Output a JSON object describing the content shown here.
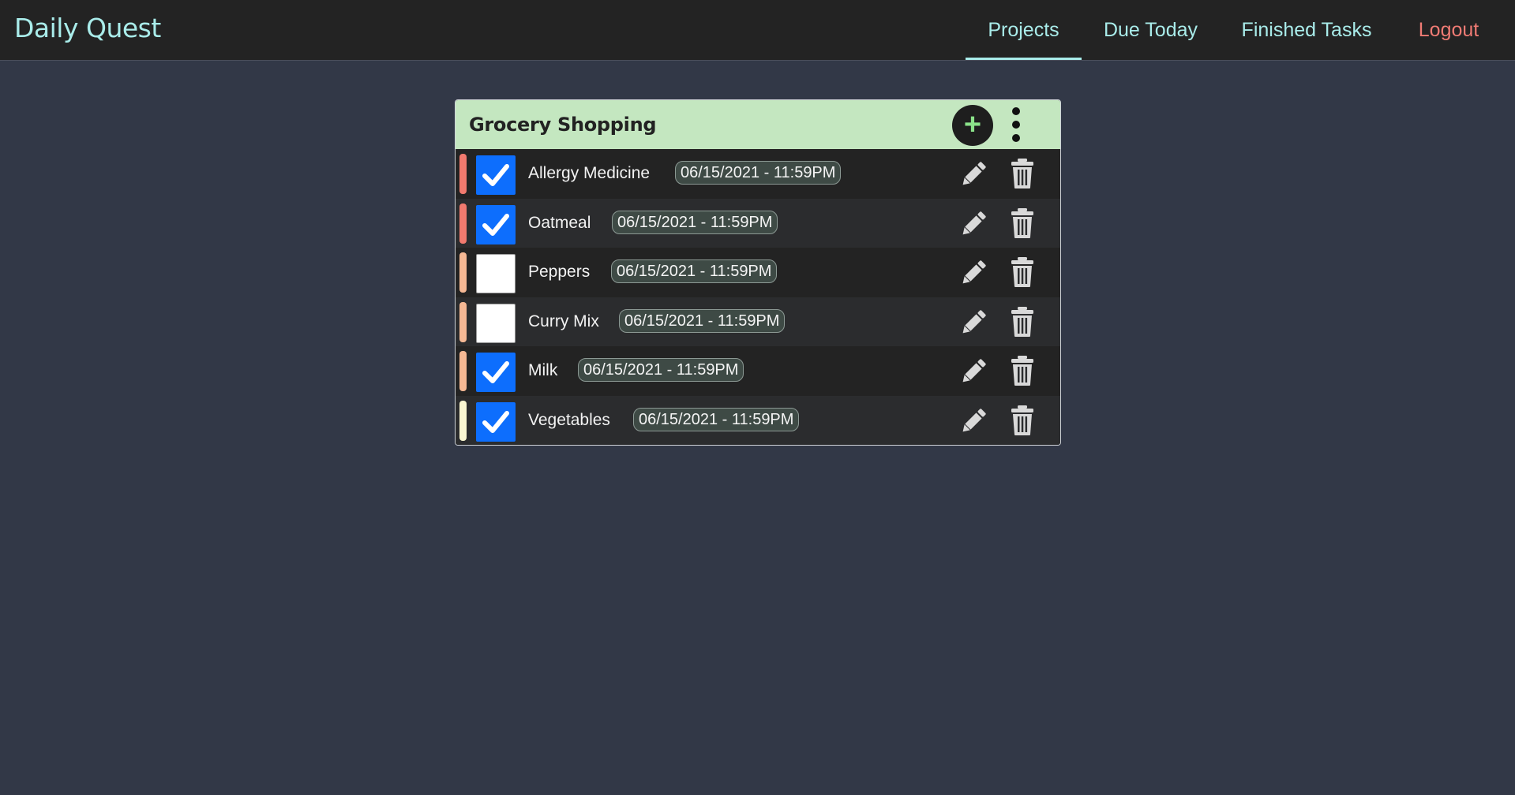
{
  "app": {
    "brand": "Daily Quest"
  },
  "nav": {
    "items": [
      {
        "label": "Projects",
        "active": true
      },
      {
        "label": "Due Today",
        "active": false
      },
      {
        "label": "Finished Tasks",
        "active": false
      },
      {
        "label": "Logout",
        "active": false
      }
    ]
  },
  "colors": {
    "background": "#323847",
    "navbar": "#232323",
    "brand_accent": "#a9ecea",
    "logout": "#f07b74",
    "header": "#c4e7c0",
    "add_plus": "#8be38a",
    "checkbox_checked": "#0d6efd",
    "priority_high": "#f27a6e",
    "priority_medium": "#f5b894",
    "priority_low": "#fbf7d2"
  },
  "project": {
    "title": "Grocery Shopping",
    "add_icon": "plus-icon",
    "menu_icon": "vertical-dots-icon",
    "tasks": [
      {
        "name": "Allergy Medicine",
        "due": "06/15/2021 - 11:59PM",
        "completed": true,
        "priority": "high"
      },
      {
        "name": "Oatmeal",
        "due": "06/15/2021 - 11:59PM",
        "completed": true,
        "priority": "high"
      },
      {
        "name": "Peppers",
        "due": "06/15/2021 - 11:59PM",
        "completed": false,
        "priority": "medium"
      },
      {
        "name": "Curry Mix",
        "due": "06/15/2021 - 11:59PM",
        "completed": false,
        "priority": "medium"
      },
      {
        "name": "Milk",
        "due": "06/15/2021 - 11:59PM",
        "completed": true,
        "priority": "medium"
      },
      {
        "name": "Vegetables",
        "due": "06/15/2021 - 11:59PM",
        "completed": true,
        "priority": "low"
      }
    ]
  }
}
